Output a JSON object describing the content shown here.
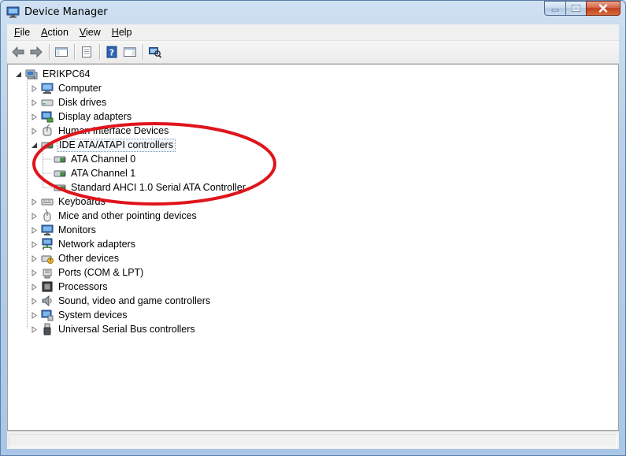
{
  "window": {
    "title": "Device Manager",
    "caption_buttons": [
      "minimize",
      "maximize",
      "close"
    ]
  },
  "menubar": {
    "items": [
      {
        "label_u": "F",
        "label_rest": "ile"
      },
      {
        "label_u": "A",
        "label_rest": "ction"
      },
      {
        "label_u": "V",
        "label_rest": "iew"
      },
      {
        "label_u": "H",
        "label_rest": "elp"
      }
    ]
  },
  "toolbar": {
    "buttons": [
      "back-icon",
      "forward-icon",
      "show-hide-console-tree-icon",
      "properties-icon",
      "help-icon",
      "show-action-pane-icon",
      "scan-hardware-icon"
    ]
  },
  "tree": {
    "root": {
      "label": "ERIKPC64",
      "icon": "computer-icon",
      "expanded": true
    },
    "categories": [
      {
        "label": "Computer",
        "icon": "computer-icon"
      },
      {
        "label": "Disk drives",
        "icon": "disk-drive-icon"
      },
      {
        "label": "Display adapters",
        "icon": "display-adapter-icon"
      },
      {
        "label": "Human Interface Devices",
        "icon": "hid-icon"
      },
      {
        "label": "IDE ATA/ATAPI controllers",
        "icon": "ide-controller-icon",
        "expanded": true,
        "selected": true,
        "children": [
          {
            "label": "ATA Channel 0",
            "icon": "ide-channel-icon"
          },
          {
            "label": "ATA Channel 1",
            "icon": "ide-channel-icon"
          },
          {
            "label": "Standard AHCI 1.0 Serial ATA Controller",
            "icon": "ide-channel-icon"
          }
        ]
      },
      {
        "label": "Keyboards",
        "icon": "keyboard-icon"
      },
      {
        "label": "Mice and other pointing devices",
        "icon": "mouse-icon"
      },
      {
        "label": "Monitors",
        "icon": "monitor-icon"
      },
      {
        "label": "Network adapters",
        "icon": "network-adapter-icon"
      },
      {
        "label": "Other devices",
        "icon": "other-devices-icon"
      },
      {
        "label": "Ports (COM & LPT)",
        "icon": "port-icon"
      },
      {
        "label": "Processors",
        "icon": "processor-icon"
      },
      {
        "label": "Sound, video and game controllers",
        "icon": "sound-icon"
      },
      {
        "label": "System devices",
        "icon": "system-devices-icon"
      },
      {
        "label": "Universal Serial Bus controllers",
        "icon": "usb-icon"
      }
    ]
  },
  "annotation": {
    "shape": "ellipse",
    "color": "#e0141c",
    "target": "IDE ATA/ATAPI controllers"
  },
  "statusbar": {
    "text": ""
  }
}
